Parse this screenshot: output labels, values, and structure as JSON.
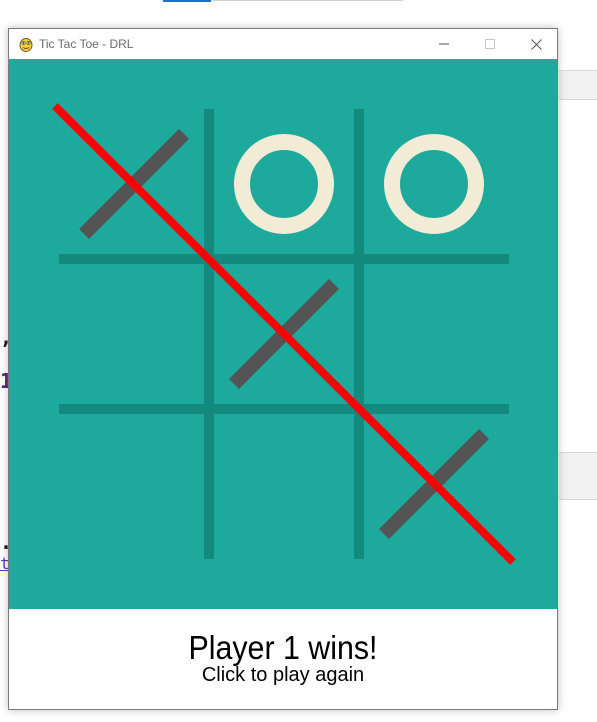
{
  "window": {
    "title": "Tic Tac Toe - DRL"
  },
  "game": {
    "colors": {
      "background": "#1da99b",
      "grid": "#14897e",
      "x_mark": "#545454",
      "o_mark": "#f2ebd5",
      "win_line": "#ff0000"
    },
    "board": [
      [
        "X",
        "O",
        "O"
      ],
      [
        "",
        "X",
        ""
      ],
      [
        "",
        "",
        "X"
      ]
    ],
    "winner": "X",
    "win_line": "diagonal-top-left-to-bottom-right"
  },
  "status": {
    "message": "Player 1 wins!",
    "hint": "Click to play again"
  },
  "background_page": {
    "fragment_1": ",",
    "fragment_2": "1",
    "fragment_3": ".",
    "fragment_4": "t"
  }
}
